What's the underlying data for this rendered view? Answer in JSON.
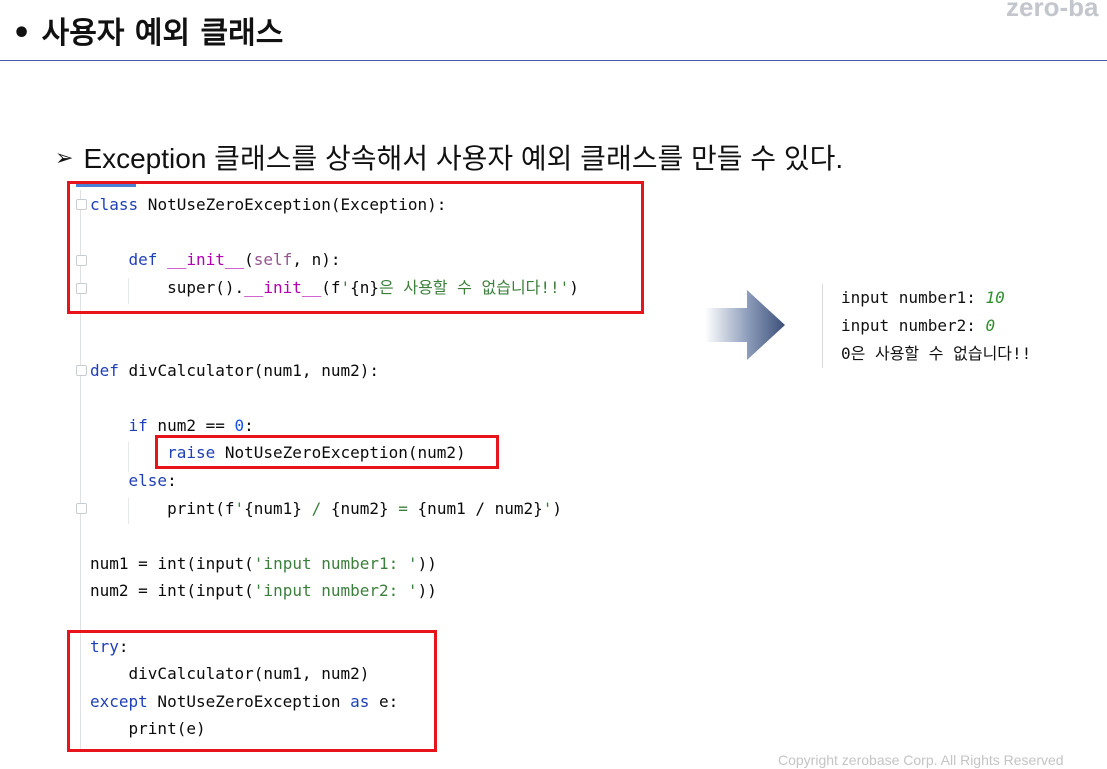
{
  "header": {
    "title": "• 사용자 예외 클래스",
    "logo_text": "zero-ba"
  },
  "bullet": {
    "arrow": "➢",
    "text": "Exception 클래스를 상속해서 사용자 예외 클래스를 만들 수 있다."
  },
  "code": {
    "lines": [
      "class NotUseZeroException(Exception):",
      "",
      "    def __init__(self, n):",
      "        super().__init__(f'{n}은 사용할 수 없습니다!!')",
      "",
      "",
      "def divCalculator(num1, num2):",
      "",
      "    if num2 == 0:",
      "        raise NotUseZeroException(num2)",
      "    else:",
      "        print(f'{num1} / {num2} = {num1 / num2}')",
      "",
      "num1 = int(input('input number1: '))",
      "num2 = int(input('input number2: '))",
      "",
      "try:",
      "    divCalculator(num1, num2)",
      "except NotUseZeroException as e:",
      "    print(e)"
    ]
  },
  "output": {
    "line1_label": "input number1: ",
    "line1_value": "10",
    "line2_label": "input number2: ",
    "line2_value": "0",
    "line3": "0은 사용할 수 없습니다!!"
  },
  "footer": {
    "copyright": "Copyright zerobase Corp. All Rights Reserved"
  },
  "colors": {
    "highlight_box": "#e8141b",
    "keyword": "#1f3fb8",
    "string": "#3c7f3c",
    "number": "#1750eb",
    "output_value": "#2f8f2f"
  }
}
